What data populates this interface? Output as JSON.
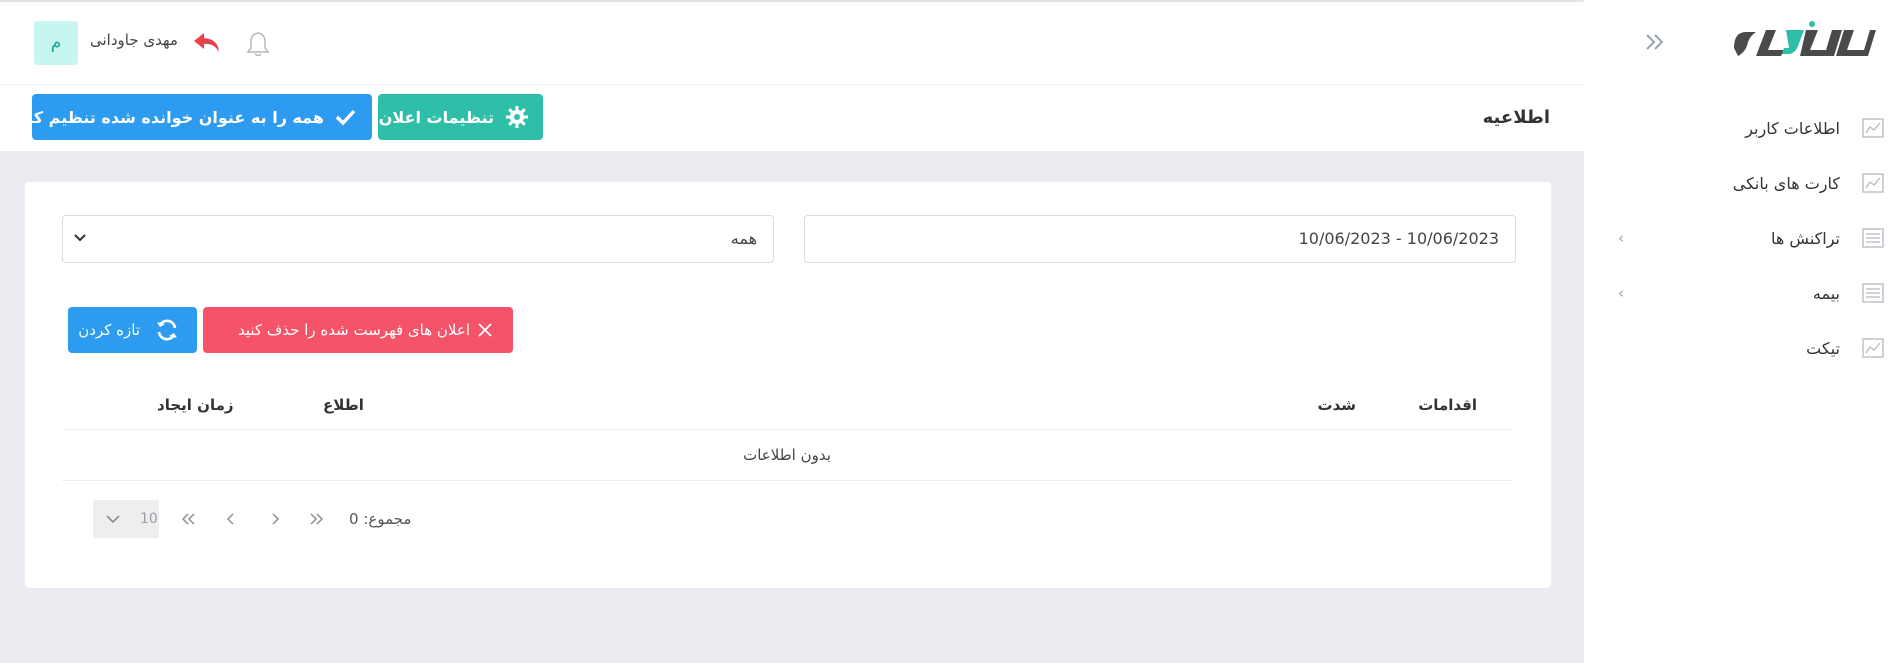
{
  "header": {
    "user_name": "مهدی جاودانی",
    "avatar_initial": "م",
    "logout_icon": "reply-arrow-icon",
    "notification_icon": "bell-icon"
  },
  "sidebar": {
    "collapse_icon": "double-chevron-right-icon",
    "items": [
      {
        "label": "اطلاعات کاربر",
        "icon": "chart-line-icon",
        "has_submenu": false
      },
      {
        "label": "کارت های بانکی",
        "icon": "chart-line-icon",
        "has_submenu": false
      },
      {
        "label": "تراکنش ها",
        "icon": "list-icon",
        "has_submenu": true
      },
      {
        "label": "بیمه",
        "icon": "list-icon",
        "has_submenu": true
      },
      {
        "label": "تیکت",
        "icon": "chart-line-icon",
        "has_submenu": false
      }
    ]
  },
  "page": {
    "title": "اطلاعیه",
    "settings_button": "تنظیمات اعلان",
    "mark_all_read_button": "همه را به عنوان خوانده شده تنظیم کنید"
  },
  "filters": {
    "date_range": "10/06/2023 - 10/06/2023",
    "type_select": "همه"
  },
  "actions": {
    "delete_listed": "اعلان های فهرست شده را حذف کنید",
    "refresh": "تازه کردن"
  },
  "table": {
    "columns": [
      "اقدامات",
      "شدت",
      "اطلاع",
      "زمان ایجاد"
    ],
    "empty_text": "بدون اطلاعات"
  },
  "pagination": {
    "total_label": "مجموع: 0",
    "page_size": "10"
  },
  "colors": {
    "primary_blue": "#2d9bf0",
    "teal": "#2fbfa8",
    "danger_red": "#f5536a",
    "logout_red": "#e8414e",
    "avatar_bg": "#c6f6ee"
  }
}
